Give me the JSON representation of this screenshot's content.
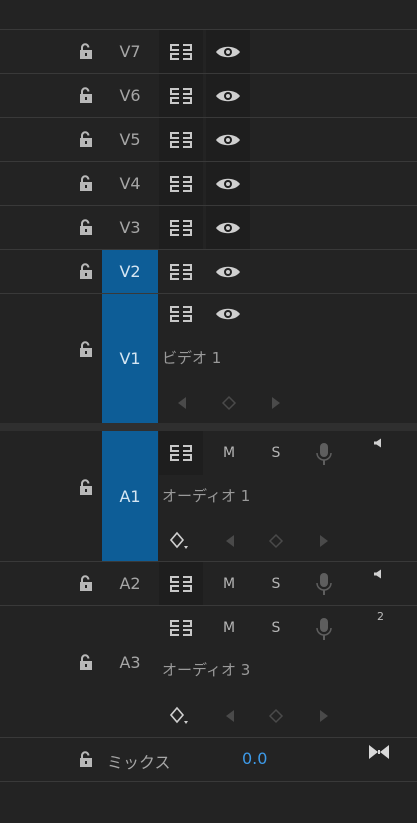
{
  "video_tracks": {
    "v7": {
      "name": "V7"
    },
    "v6": {
      "name": "V6"
    },
    "v5": {
      "name": "V5"
    },
    "v4": {
      "name": "V4"
    },
    "v3": {
      "name": "V3"
    },
    "v2": {
      "name": "V2"
    },
    "v1": {
      "name": "V1",
      "clip_label": "ビデオ 1"
    }
  },
  "audio_tracks": {
    "a1": {
      "name": "A1",
      "clip_label": "オーディオ 1",
      "mute_label": "M",
      "solo_label": "S"
    },
    "a2": {
      "name": "A2",
      "mute_label": "M",
      "solo_label": "S"
    },
    "a3": {
      "name": "A3",
      "clip_label": "オーディオ 3",
      "mute_label": "M",
      "solo_label": "S",
      "channel_badge": "2"
    }
  },
  "mix": {
    "label": "ミックス",
    "value": "0.0"
  },
  "icons": {
    "lock": "lock-icon",
    "sync": "sync-lock-icon",
    "eye": "eye-icon",
    "mic": "mic-icon",
    "speaker": "speaker-icon",
    "keyframe": "keyframe-icon",
    "bowtie": "bowtie-icon"
  },
  "colors": {
    "target_track": "#0d5d97",
    "value_text": "#3d9ae8",
    "background": "#232323"
  }
}
